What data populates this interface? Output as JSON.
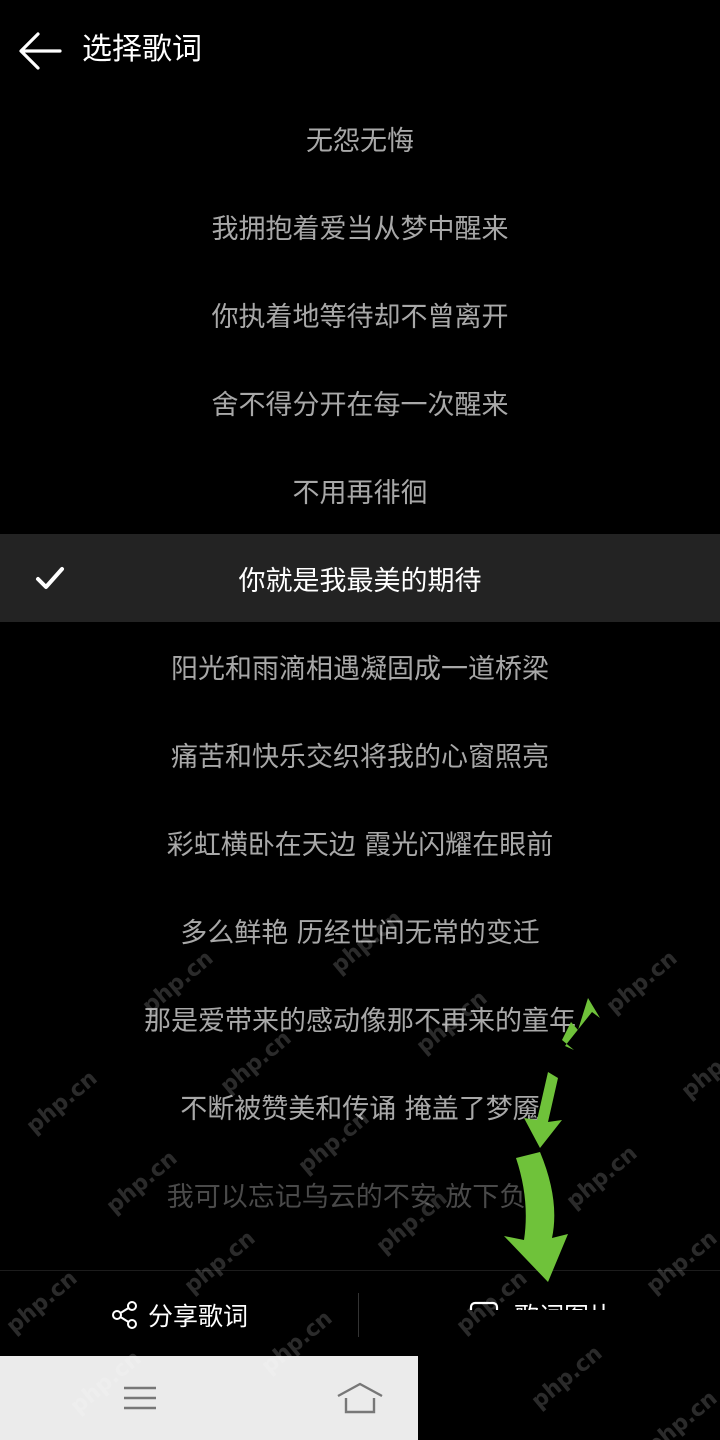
{
  "header": {
    "title": "选择歌词"
  },
  "lyrics": [
    "无怨无悔",
    "我拥抱着爱当从梦中醒来",
    "你执着地等待却不曾离开",
    "舍不得分开在每一次醒来",
    "不用再徘徊",
    "你就是我最美的期待",
    "阳光和雨滴相遇凝固成一道桥梁",
    "痛苦和快乐交织将我的心窗照亮",
    "彩虹横卧在天边 霞光闪耀在眼前",
    "多么鲜艳 历经世间无常的变迁",
    "那是爱带来的感动像那不再来的童年",
    "不断被赞美和传诵 掩盖了梦魇",
    "我可以忘记乌云的不安 放下负担"
  ],
  "bottom": {
    "share_label": "分享歌词",
    "image_label": "歌词图片"
  },
  "watermark": "php.cn",
  "colors": {
    "background": "#000000",
    "selected_row": "#232323",
    "arrow": "#6fc23a",
    "nav_bar": "#ebebeb"
  },
  "icons": [
    "back-arrow-icon",
    "check-icon",
    "share-icon",
    "image-icon",
    "menu-icon",
    "home-icon"
  ]
}
